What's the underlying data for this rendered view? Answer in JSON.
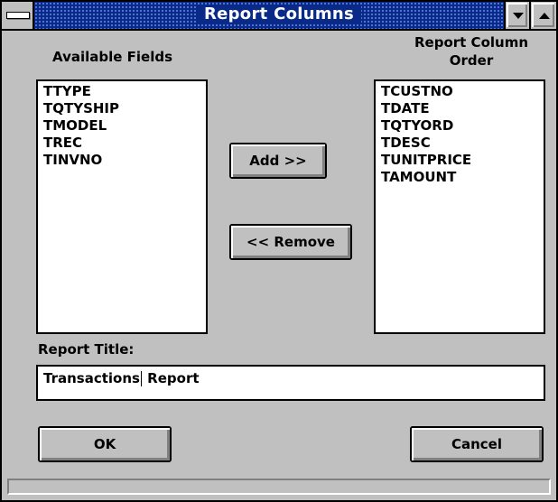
{
  "window": {
    "title": "Report Columns"
  },
  "available_fields": {
    "label": "Available Fields",
    "items": [
      "TTYPE",
      "TQTYSHIP",
      "TMODEL",
      "TREC",
      "TINVNO"
    ]
  },
  "report_columns": {
    "label_line1": "Report Column",
    "label_line2": "Order",
    "items": [
      "TCUSTNO",
      "TDATE",
      "TQTYORD",
      "TDESC",
      "TUNITPRICE",
      "TAMOUNT"
    ]
  },
  "buttons": {
    "add": "Add >>",
    "remove": "<< Remove",
    "ok": "OK",
    "cancel": "Cancel"
  },
  "report_title": {
    "label": "Report Title:",
    "value_before_caret": "Transactions",
    "value_after_caret": " Report"
  }
}
